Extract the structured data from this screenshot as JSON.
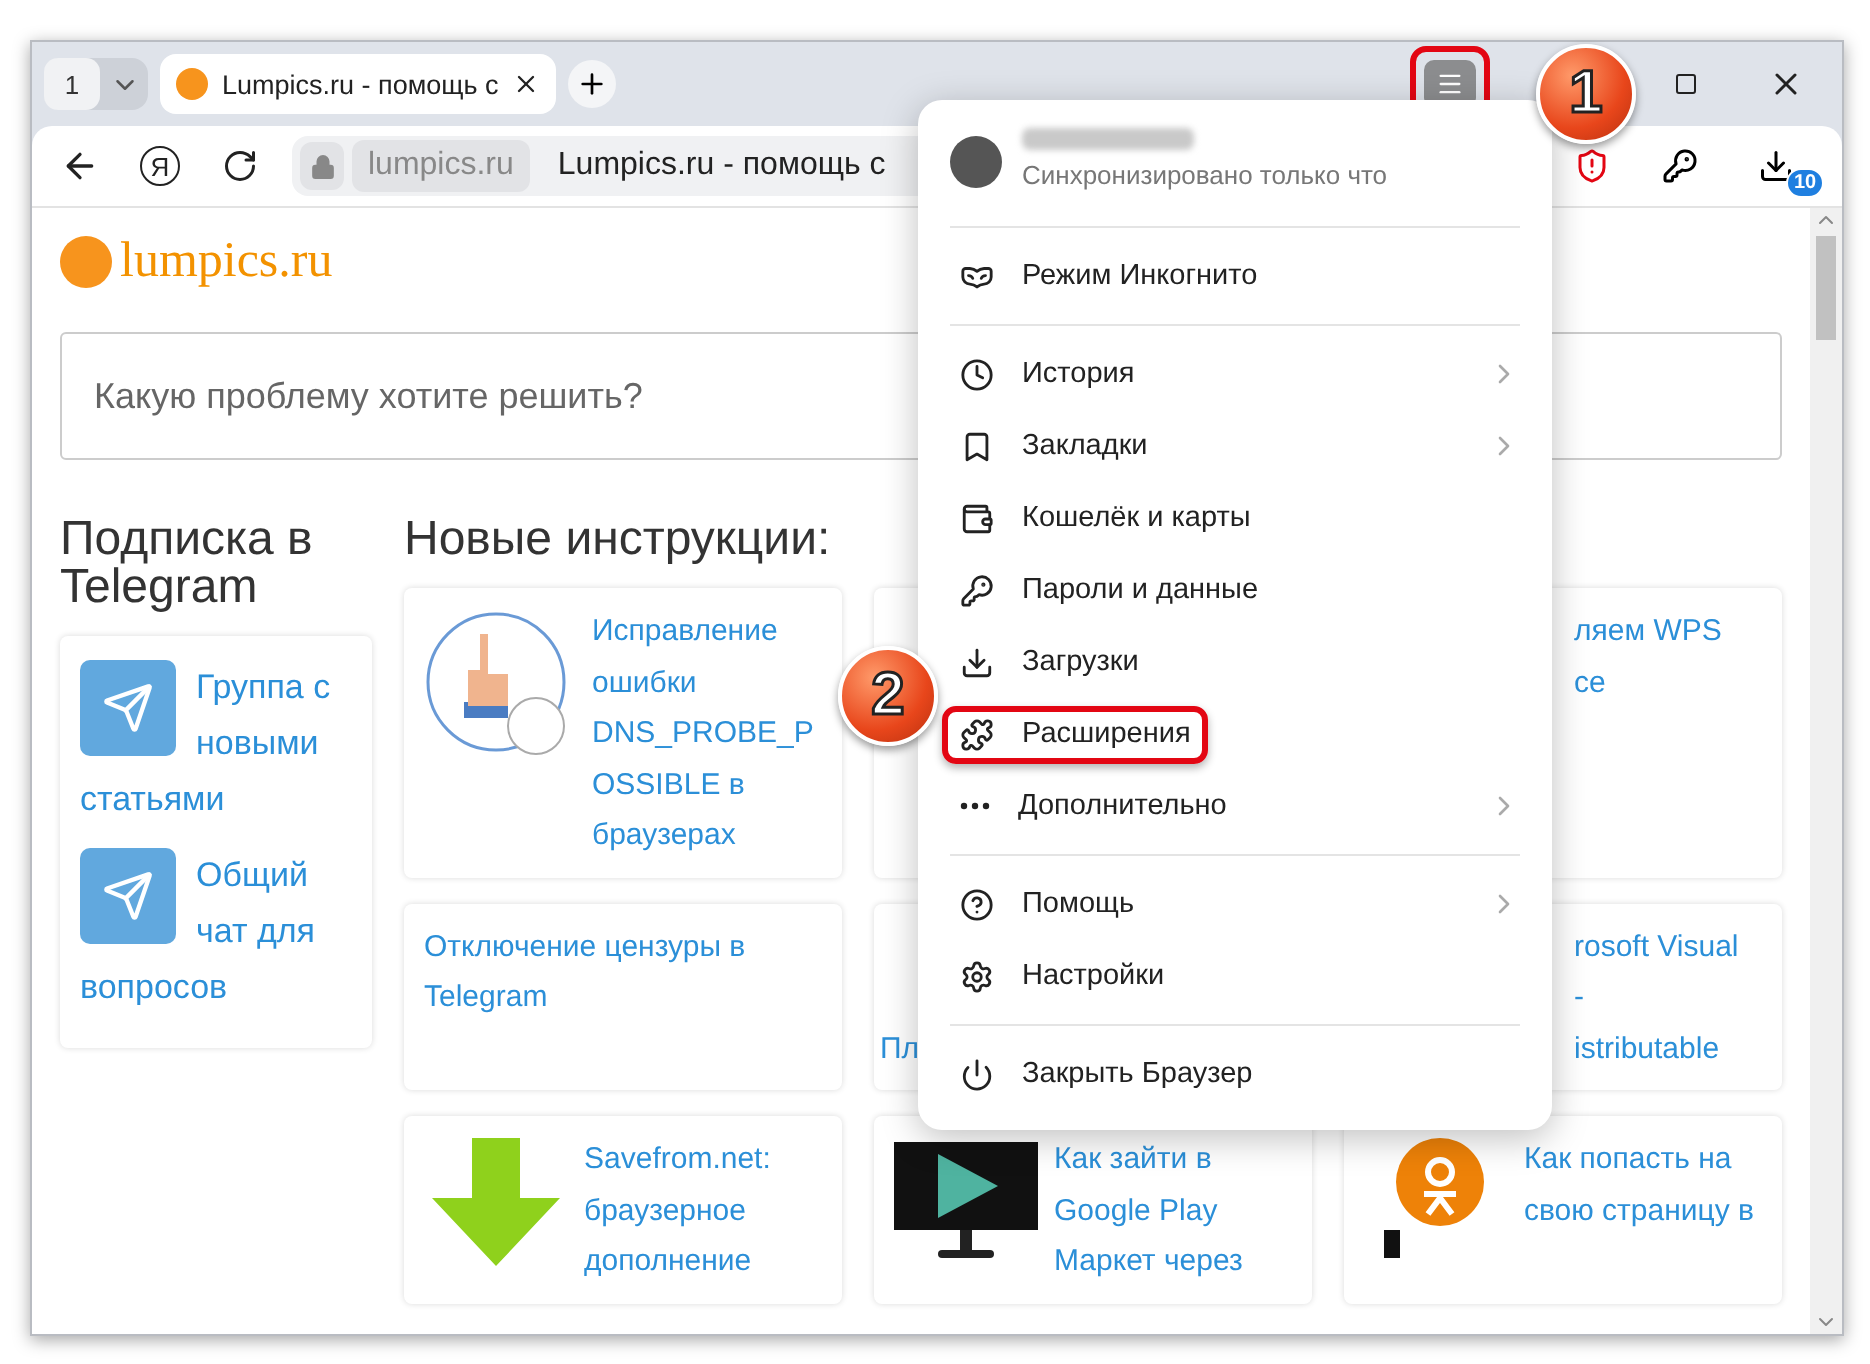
{
  "tab_strip": {
    "tab_count": "1",
    "tabs": [
      {
        "title": "Lumpics.ru - помощь с",
        "selected": true
      }
    ],
    "menu_button": {
      "highlighted": true
    }
  },
  "toolbar": {
    "home_glyph": "Я",
    "address": {
      "domain": "lumpics.ru",
      "page_title": "Lumpics.ru - помощь с"
    },
    "downloads_badge": "10"
  },
  "page": {
    "logo": "lumpics.ru",
    "search": {
      "placeholder": "Какую проблему хотите решить?"
    },
    "sidebar": {
      "heading": "Подписка в Telegram",
      "links": [
        "Группа с новыми статьями",
        "Общий чат для вопросов"
      ]
    },
    "articles_heading": "Новые инструкции:",
    "articles": [
      {
        "kind": "full",
        "title": "Исправление ошибки DNS_PROBE_POSSIBLE в браузерах"
      },
      {
        "kind": "covered"
      },
      {
        "kind": "covered",
        "lines": [
          "ляем WPS",
          "ce"
        ]
      },
      {
        "kind": "full",
        "title": "Отключение цензуры в Telegram"
      },
      {
        "kind": "covered",
        "lines": [
          "Пл"
        ]
      },
      {
        "kind": "covered",
        "lines": [
          "rosoft Visual",
          "-",
          "istributable"
        ]
      },
      {
        "kind": "full",
        "title": "Savefrom.net: браузерное дополнение"
      },
      {
        "kind": "full",
        "title": "Как зайти в Google Play Маркет через"
      },
      {
        "kind": "full",
        "title": "Как попасть на свою страницу в"
      }
    ]
  },
  "menu": {
    "profile": {
      "status": "Синхронизировано только что"
    },
    "groups": [
      [
        {
          "label": "Режим Инкогнито",
          "submenu": false,
          "highlighted": false
        }
      ],
      [
        {
          "label": "История",
          "submenu": true,
          "highlighted": false
        },
        {
          "label": "Закладки",
          "submenu": true,
          "highlighted": false
        },
        {
          "label": "Кошелёк и карты",
          "submenu": false,
          "highlighted": false
        },
        {
          "label": "Пароли и данные",
          "submenu": false,
          "highlighted": false
        },
        {
          "label": "Загрузки",
          "submenu": false,
          "highlighted": false
        },
        {
          "label": "Расширения",
          "submenu": false,
          "highlighted": true
        },
        {
          "label": "Дополнительно",
          "submenu": true,
          "highlighted": false
        }
      ],
      [
        {
          "label": "Помощь",
          "submenu": true,
          "highlighted": false
        },
        {
          "label": "Настройки",
          "submenu": false,
          "highlighted": false
        }
      ],
      [
        {
          "label": "Закрыть Браузер",
          "submenu": false,
          "highlighted": false
        }
      ]
    ]
  },
  "annotations": [
    "1",
    "2"
  ]
}
